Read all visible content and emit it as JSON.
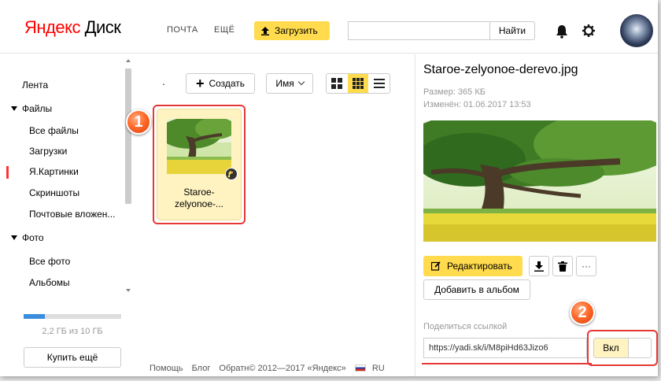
{
  "header": {
    "logo_brand": "Яндекс",
    "logo_product": "Диск",
    "nav_mail": "ПОЧТА",
    "nav_more": "ЕЩЁ",
    "upload_label": "Загрузить",
    "search_button": "Найти",
    "search_value": ""
  },
  "sidebar": {
    "items": [
      {
        "label": "Лента"
      },
      {
        "label": "Файлы"
      },
      {
        "label": "Все файлы"
      },
      {
        "label": "Загрузки"
      },
      {
        "label": "Я.Картинки"
      },
      {
        "label": "Скриншоты"
      },
      {
        "label": "Почтовые вложен..."
      },
      {
        "label": "Фото"
      },
      {
        "label": "Все фото"
      },
      {
        "label": "Альбомы"
      }
    ],
    "quota_fraction": 0.22,
    "quota_text": "2,2 ГБ из 10 ГБ",
    "buy_button": "Купить ещё"
  },
  "main": {
    "path_dot": ".",
    "create_button": "Создать",
    "sort_button": "Имя",
    "file": {
      "name": "Staroe-zelyonoe-..."
    },
    "markers": {
      "one": "1",
      "two": "2"
    },
    "footer": {
      "help": "Помощь",
      "blog": "Блог",
      "feedback": "Обратн",
      "copyright": "© 2012—2017 «Яндекс»",
      "lang": "RU"
    }
  },
  "panel": {
    "title": "Staroe-zelyonoe-derevo.jpg",
    "size": "Размер: 365 КБ",
    "modified": "Изменён: 01.06.2017 13:53",
    "edit_button": "Редактировать",
    "more_button": "···",
    "album_button": "Добавить в альбом",
    "share_label": "Поделиться ссылкой",
    "share_link": "https://yadi.sk/i/M8piHd63Jizo6",
    "toggle_label": "Вкл"
  },
  "colors": {
    "accent": "#ffdb4d",
    "highlight": "#e53935",
    "link_blue": "#3a8dde",
    "brand_red": "#ff0000"
  }
}
